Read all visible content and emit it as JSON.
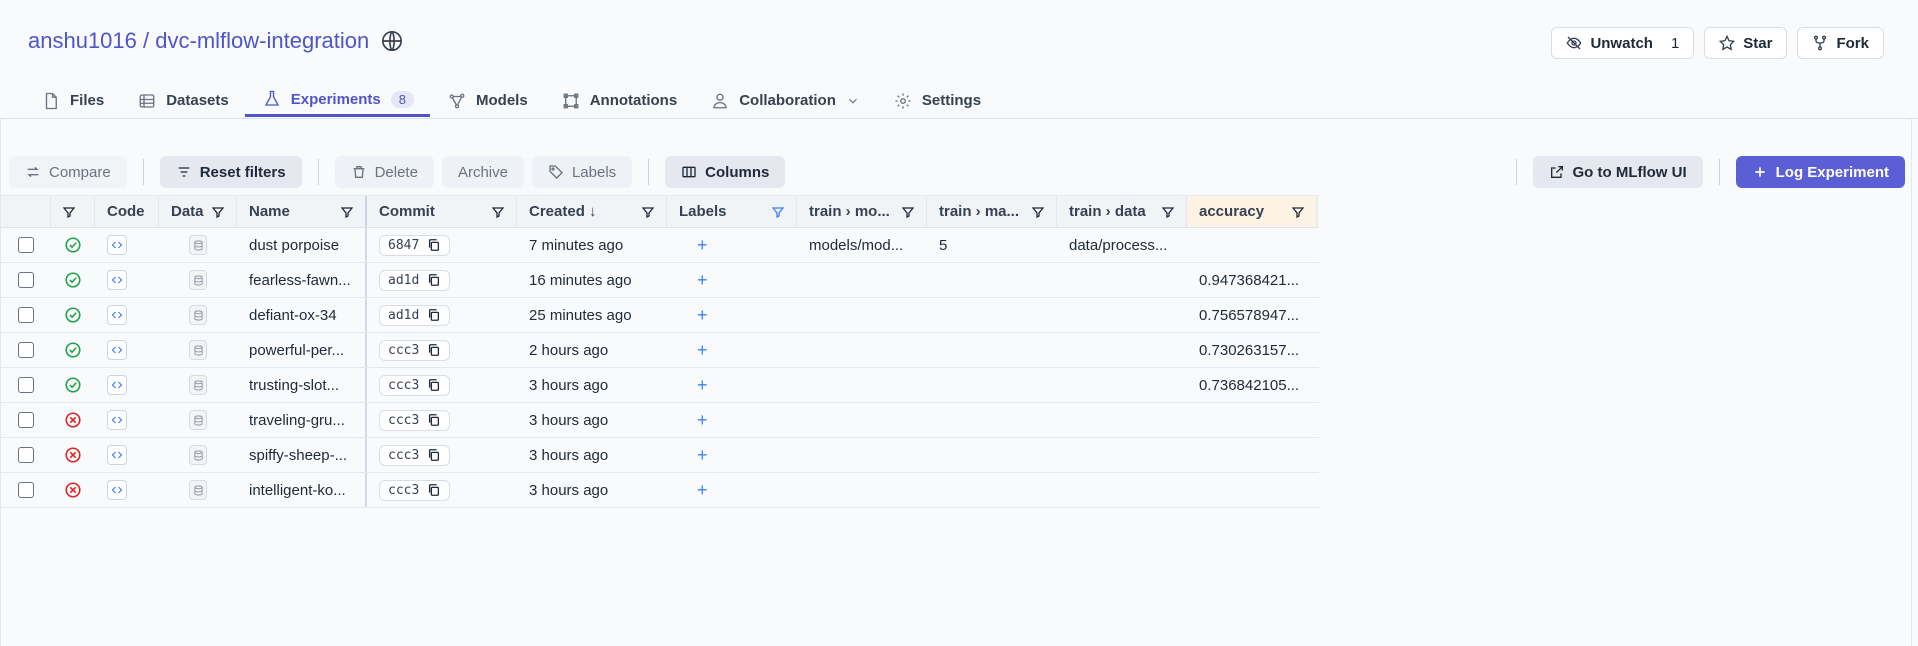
{
  "repo": {
    "owner": "anshu1016",
    "separator": "/",
    "name": "dvc-mlflow-integration"
  },
  "repo_actions": {
    "unwatch": {
      "label": "Unwatch",
      "count": "1"
    },
    "star": {
      "label": "Star"
    },
    "fork": {
      "label": "Fork"
    }
  },
  "tabs": [
    {
      "label": "Files"
    },
    {
      "label": "Datasets"
    },
    {
      "label": "Experiments",
      "badge": "8"
    },
    {
      "label": "Models"
    },
    {
      "label": "Annotations"
    },
    {
      "label": "Collaboration"
    },
    {
      "label": "Settings"
    }
  ],
  "toolbar": {
    "compare": "Compare",
    "reset_filters": "Reset filters",
    "delete": "Delete",
    "archive": "Archive",
    "labels": "Labels",
    "columns": "Columns",
    "mlflow": "Go to MLflow UI",
    "log": "Log Experiment"
  },
  "columns": {
    "code": "Code",
    "data": "Data",
    "name": "Name",
    "commit": "Commit",
    "created": "Created",
    "labels": "Labels",
    "train_model": "train › mo...",
    "train_max": "train › ma...",
    "train_data": "train › data",
    "accuracy": "accuracy"
  },
  "rows": [
    {
      "status": "success",
      "name": "dust porpoise",
      "commit": "6847",
      "created": "7 minutes ago",
      "train_model": "models/mod...",
      "train_max": "5",
      "train_data": "data/process...",
      "accuracy": ""
    },
    {
      "status": "success",
      "name": "fearless-fawn...",
      "commit": "ad1d",
      "created": "16 minutes ago",
      "train_model": "",
      "train_max": "",
      "train_data": "",
      "accuracy": "0.947368421..."
    },
    {
      "status": "success",
      "name": "defiant-ox-34",
      "commit": "ad1d",
      "created": "25 minutes ago",
      "train_model": "",
      "train_max": "",
      "train_data": "",
      "accuracy": "0.756578947..."
    },
    {
      "status": "success",
      "name": "powerful-per...",
      "commit": "ccc3",
      "created": "2 hours ago",
      "train_model": "",
      "train_max": "",
      "train_data": "",
      "accuracy": "0.730263157..."
    },
    {
      "status": "success",
      "name": "trusting-slot...",
      "commit": "ccc3",
      "created": "3 hours ago",
      "train_model": "",
      "train_max": "",
      "train_data": "",
      "accuracy": "0.736842105..."
    },
    {
      "status": "failed",
      "name": "traveling-gru...",
      "commit": "ccc3",
      "created": "3 hours ago",
      "train_model": "",
      "train_max": "",
      "train_data": "",
      "accuracy": ""
    },
    {
      "status": "failed",
      "name": "spiffy-sheep-...",
      "commit": "ccc3",
      "created": "3 hours ago",
      "train_model": "",
      "train_max": "",
      "train_data": "",
      "accuracy": ""
    },
    {
      "status": "failed",
      "name": "intelligent-ko...",
      "commit": "ccc3",
      "created": "3 hours ago",
      "train_model": "",
      "train_max": "",
      "train_data": "",
      "accuracy": ""
    }
  ],
  "colors": {
    "accent": "#5b5fd6",
    "success": "#22a34a",
    "failed": "#dc2626",
    "link": "#3b82f6"
  }
}
